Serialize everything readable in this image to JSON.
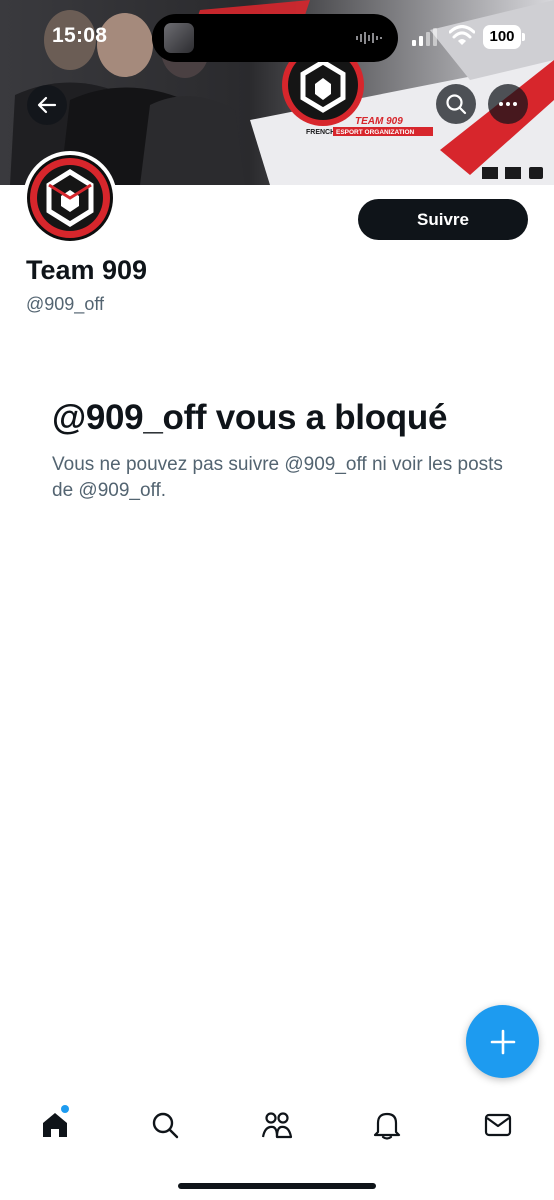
{
  "status_bar": {
    "time": "15:08",
    "battery": "100"
  },
  "banner": {
    "team_label": "TEAM 909",
    "org_prefix": "FRENCH",
    "org_label": "ESPORT ORGANIZATION",
    "colors": {
      "accent": "#d7262c",
      "dark": "#1a1a1c",
      "light": "#e9e9ec"
    }
  },
  "profile": {
    "display_name": "Team 909",
    "handle": "@909_off",
    "follow_label": "Suivre"
  },
  "blocked": {
    "title": "@909_off vous a bloqué",
    "description": "Vous ne pouvez pas suivre @909_off ni voir les posts de @909_off."
  },
  "icons": {
    "back": "arrow-left-icon",
    "search": "search-icon",
    "more": "more-icon",
    "compose": "plus-icon",
    "home": "home-icon",
    "explore": "search-icon",
    "communities": "people-icon",
    "notifications": "bell-icon",
    "messages": "envelope-icon"
  },
  "colors": {
    "primary_text": "#0f1419",
    "secondary_text": "#536471",
    "brand_blue": "#1d9bf0"
  }
}
